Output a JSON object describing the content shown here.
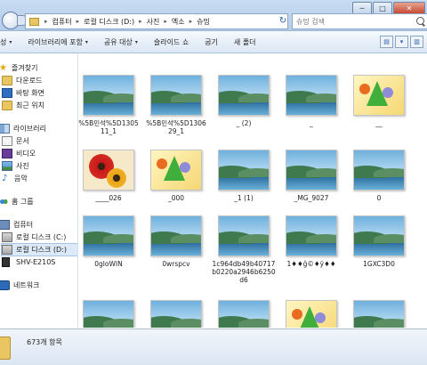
{
  "window": {
    "min": "─",
    "max": "□",
    "close": "✕"
  },
  "address": {
    "crumbs": [
      "컴퓨터",
      "로컬 디스크 (D:)",
      "사진",
      "엑소",
      "슈밍"
    ]
  },
  "search": {
    "placeholder": "슈밍 검색"
  },
  "toolbar": {
    "organize": "성",
    "include_library": "라이브러리에 포함",
    "share_with": "공유 대상",
    "slideshow": "슬라이드 쇼",
    "burn": "굽기",
    "new_folder": "새 폴더"
  },
  "sidebar": {
    "favorites": "즐겨찾기",
    "downloads": "다운로드",
    "desktop": "바탕 화면",
    "recent": "최근 위치",
    "libraries": "라이브러리",
    "documents": "문서",
    "videos": "비디오",
    "pictures": "사진",
    "music": "음악",
    "homegroup": "홈 그룹",
    "computer": "컴퓨터",
    "drive_c": "로컬 디스크 (C:)",
    "drive_d": "로컬 디스크 (D:)",
    "phone": "SHV-E210S",
    "network": "네트워크"
  },
  "files": [
    {
      "label": "%5B민석%5D130511_1",
      "thumb": "landscape"
    },
    {
      "label": "%5B민석%5D130629_1",
      "thumb": "landscape"
    },
    {
      "label": "_ (2)",
      "thumb": "landscape"
    },
    {
      "label": "_",
      "thumb": "landscape"
    },
    {
      "label": "__",
      "thumb": "shapes"
    },
    {
      "label": "____026",
      "thumb": "flowers"
    },
    {
      "label": "_000",
      "thumb": "shapes"
    },
    {
      "label": "_1 (1)",
      "thumb": "landscape"
    },
    {
      "label": "_MG_9027",
      "thumb": "landscape"
    },
    {
      "label": "0",
      "thumb": "landscape"
    },
    {
      "label": "0gloWIN",
      "thumb": "landscape"
    },
    {
      "label": "0wrspcv",
      "thumb": "landscape"
    },
    {
      "label": "1c964db49b40717b0220a2946b6250d6",
      "thumb": "landscape"
    },
    {
      "label": "1♦♦ğ©♦ÿ♦♦",
      "thumb": "landscape"
    },
    {
      "label": "1GXC3D0",
      "thumb": "landscape"
    },
    {
      "label": "",
      "thumb": "landscape"
    },
    {
      "label": "",
      "thumb": "landscape"
    },
    {
      "label": "",
      "thumb": "landscape"
    },
    {
      "label": "",
      "thumb": "shapes"
    },
    {
      "label": "",
      "thumb": "landscape"
    }
  ],
  "status": {
    "item_count": "673개 항목"
  }
}
